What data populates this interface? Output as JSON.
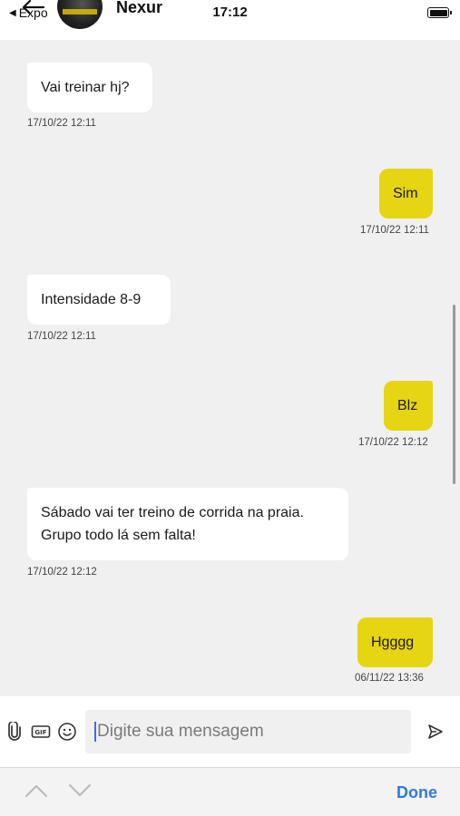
{
  "header": {
    "back_app_label": "Expo",
    "contact_name": "Nexur",
    "time": "17:12"
  },
  "messages": [
    {
      "text": "Vai treinar hj?",
      "timestamp": "17/10/22 12:11",
      "direction": "incoming"
    },
    {
      "text": "Sim",
      "timestamp": "17/10/22 12:11",
      "direction": "outgoing"
    },
    {
      "text": "Intensidade 8-9",
      "timestamp": "17/10/22 12:11",
      "direction": "incoming"
    },
    {
      "text": "Blz",
      "timestamp": "17/10/22 12:12",
      "direction": "outgoing"
    },
    {
      "text": "Sábado vai ter treino de corrida na praia. Grupo todo lá sem falta!",
      "timestamp": "17/10/22 12:12",
      "direction": "incoming"
    },
    {
      "text": "Hgggg",
      "timestamp": "06/11/22 13:36",
      "direction": "outgoing"
    }
  ],
  "composer": {
    "placeholder": "Digite sua mensagem",
    "icons": [
      "paperclip-icon",
      "gif-icon",
      "emoji-icon",
      "send-icon"
    ]
  },
  "accessory": {
    "done_label": "Done"
  },
  "colors": {
    "outgoing_bubble": "#e6d513",
    "incoming_bubble": "#ffffff",
    "background": "#f0f0f0",
    "accent": "#2f7bd8"
  }
}
